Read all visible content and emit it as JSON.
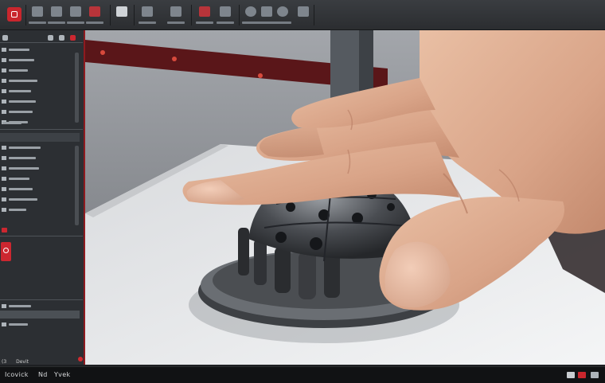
{
  "ribbon": {
    "app_button": "app-menu"
  },
  "left_panel": {
    "footer_left": "(3",
    "footer_mid": "Devit"
  },
  "status_bar": {
    "label_1": "Icovick",
    "label_2": "Nd",
    "label_3": "Yvek"
  },
  "colors": {
    "accent": "#c9262d",
    "panel_bg": "#2c2f33",
    "ribbon_bg": "#2f3236"
  }
}
